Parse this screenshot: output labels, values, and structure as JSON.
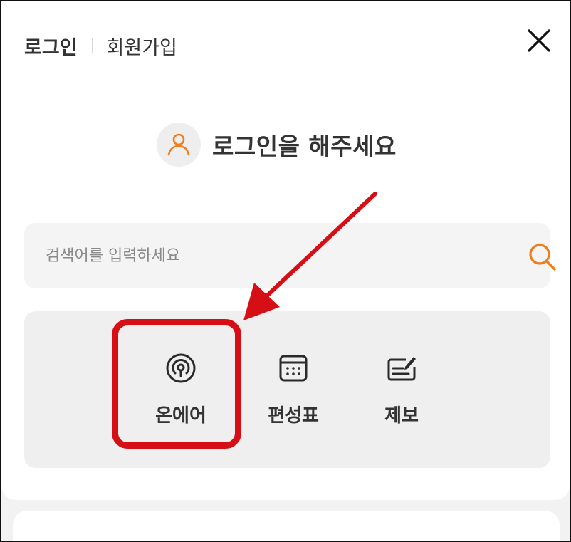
{
  "header": {
    "login_tab": "로그인",
    "signup_tab": "회원가입",
    "close_icon": "close-x-icon"
  },
  "profile": {
    "prompt": "로그인을 해주세요",
    "avatar_icon": "user-icon",
    "accent_color": "#f07c1b"
  },
  "search": {
    "placeholder": "검색어를 입력하세요",
    "value": "",
    "icon": "search-icon"
  },
  "menu": {
    "items": [
      {
        "label": "온에어",
        "icon": "on-air-broadcast-icon"
      },
      {
        "label": "편성표",
        "icon": "schedule-calendar-icon"
      },
      {
        "label": "제보",
        "icon": "report-pen-icon"
      }
    ]
  },
  "annotation": {
    "color": "#d60f16",
    "target": "온에어"
  }
}
